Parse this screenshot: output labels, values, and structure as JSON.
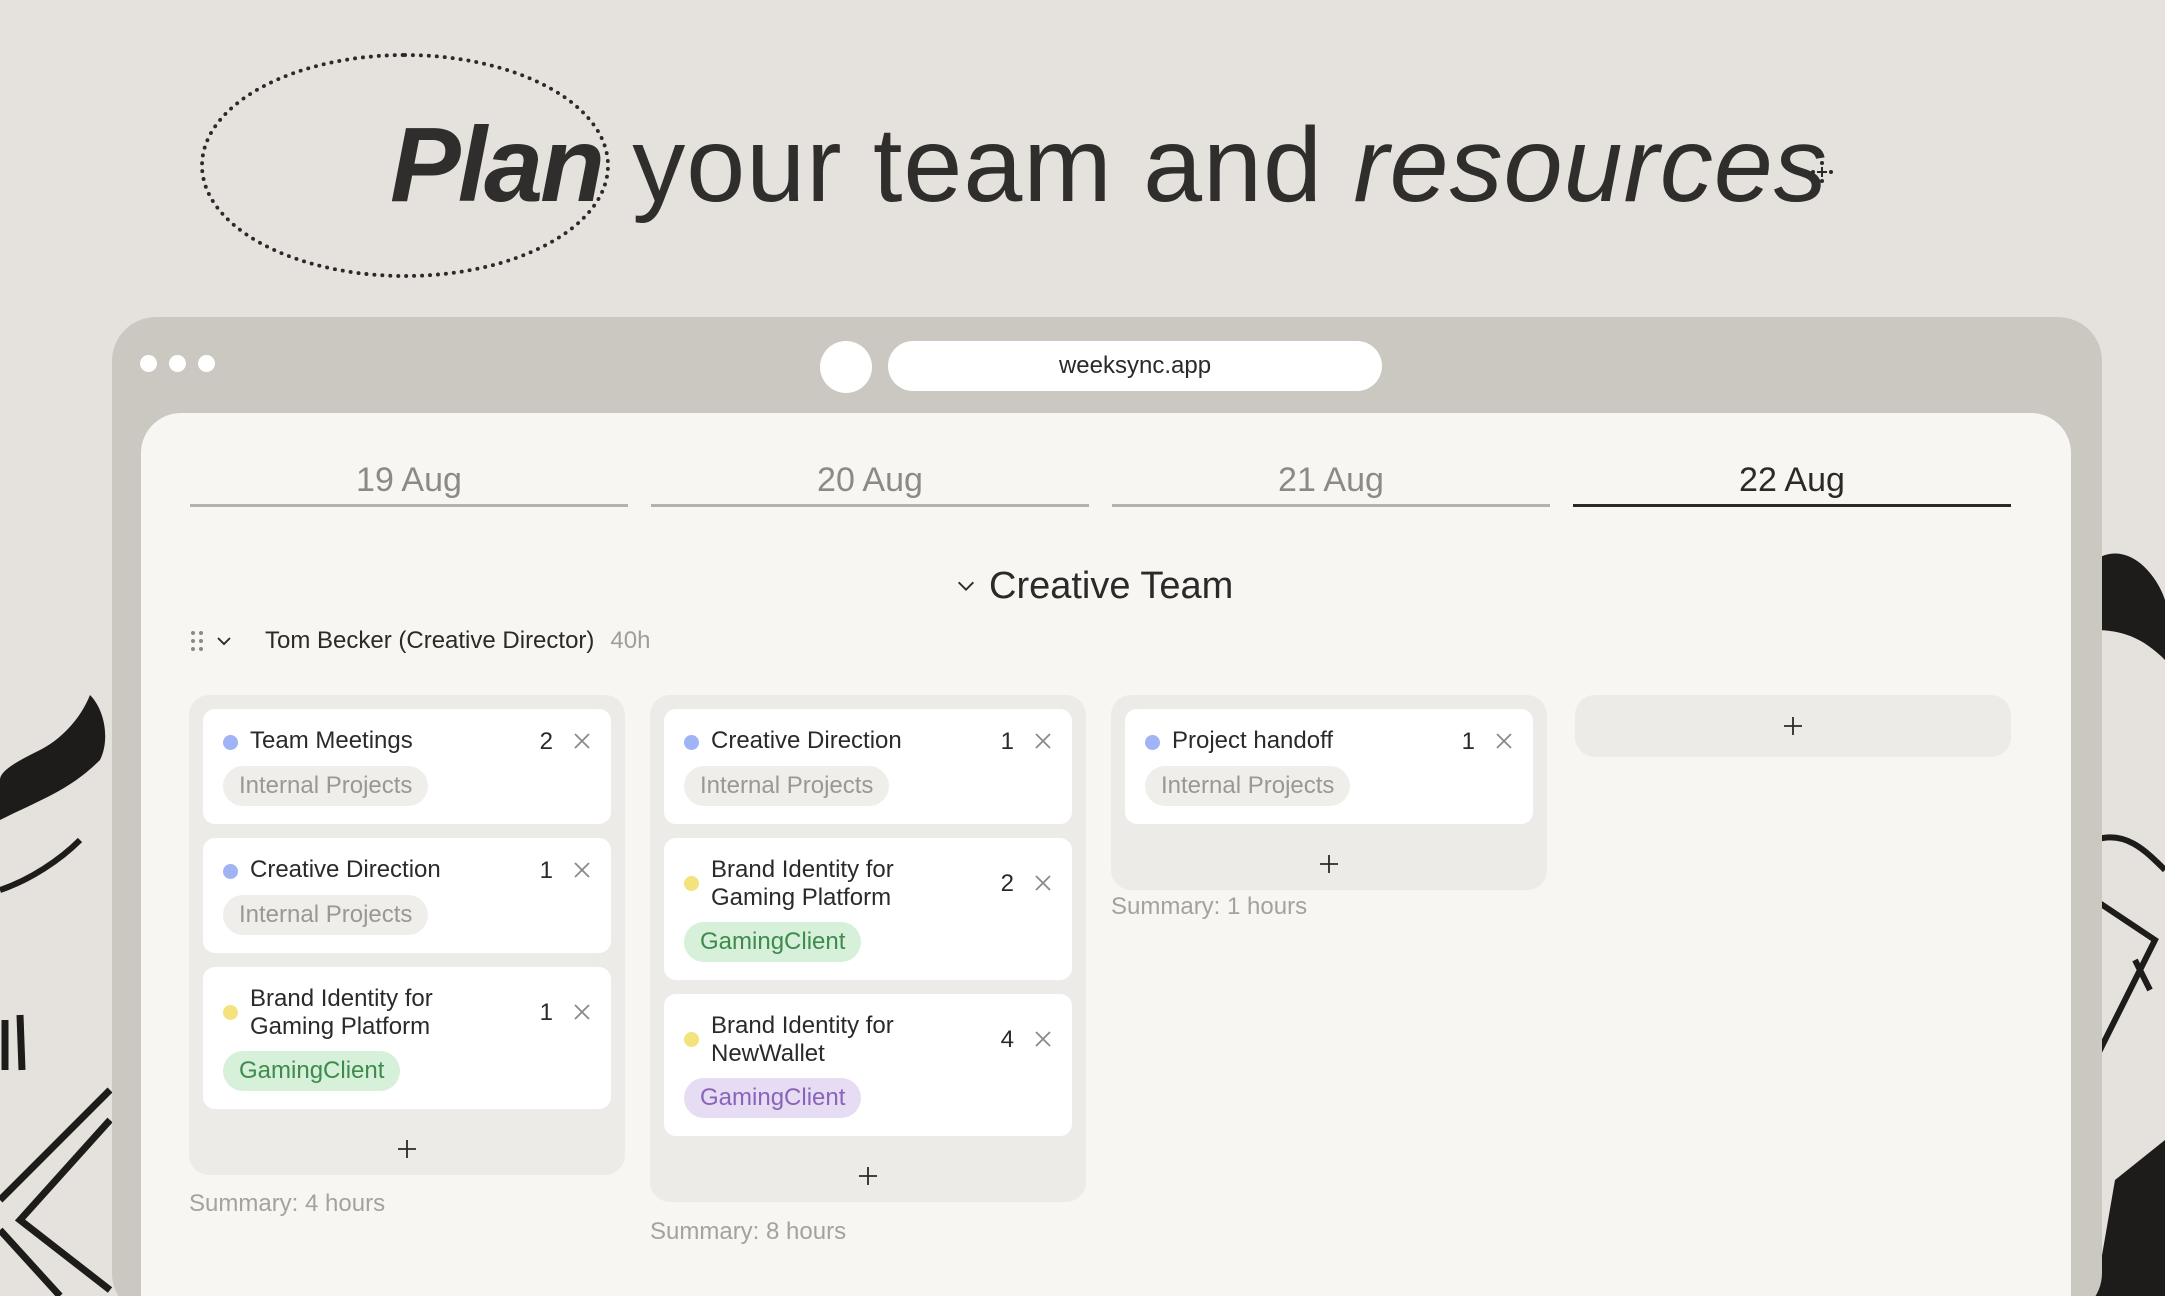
{
  "hero": {
    "word_plan": "Plan",
    "word_middle": " your team and ",
    "word_resources": "resources"
  },
  "browser": {
    "url": "weeksync.app"
  },
  "dates": [
    "19 Aug",
    "20 Aug",
    "21 Aug",
    "22 Aug"
  ],
  "active_date": "22 Aug",
  "team": {
    "name": "Creative Team",
    "person": "Tom Becker (Creative Director)",
    "capacity": "40h"
  },
  "columns": [
    {
      "cards": [
        {
          "title": "Team Meetings",
          "count": "2",
          "tag": "Internal Projects",
          "dot": "blue"
        },
        {
          "title": "Creative Direction",
          "count": "1",
          "tag": "Internal Projects",
          "dot": "blue"
        },
        {
          "title": "Brand Identity for Gaming Platform",
          "count": "1",
          "tag": "GamingClient",
          "dot": "yellow"
        }
      ],
      "summary": "Summary: 4 hours"
    },
    {
      "cards": [
        {
          "title": "Creative Direction",
          "count": "1",
          "tag": "Internal Projects",
          "dot": "blue"
        },
        {
          "title": "Brand Identity for Gaming Platform",
          "count": "2",
          "tag": "GamingClient",
          "dot": "yellow"
        },
        {
          "title": "Brand Identity for NewWallet",
          "count": "4",
          "tag": "GamingClient",
          "dot": "yellow"
        }
      ],
      "summary": "Summary: 8 hours"
    },
    {
      "cards": [
        {
          "title": "Project handoff",
          "count": "1",
          "tag": "Internal Projects",
          "dot": "blue"
        }
      ],
      "summary": "Summary: 1 hours"
    }
  ],
  "colors": {
    "background": "#e5e2dd",
    "browser_frame": "#cbc8c1",
    "content": "#f7f6f3",
    "dot_blue": "#9fb3f5",
    "dot_yellow": "#f3e27d",
    "tag_green": "#d6f0d9",
    "tag_purple": "#e6dcf4"
  },
  "icons": [
    "move-icon",
    "drag-handle-icon",
    "chevron-down-icon",
    "close-icon",
    "plus-icon"
  ]
}
